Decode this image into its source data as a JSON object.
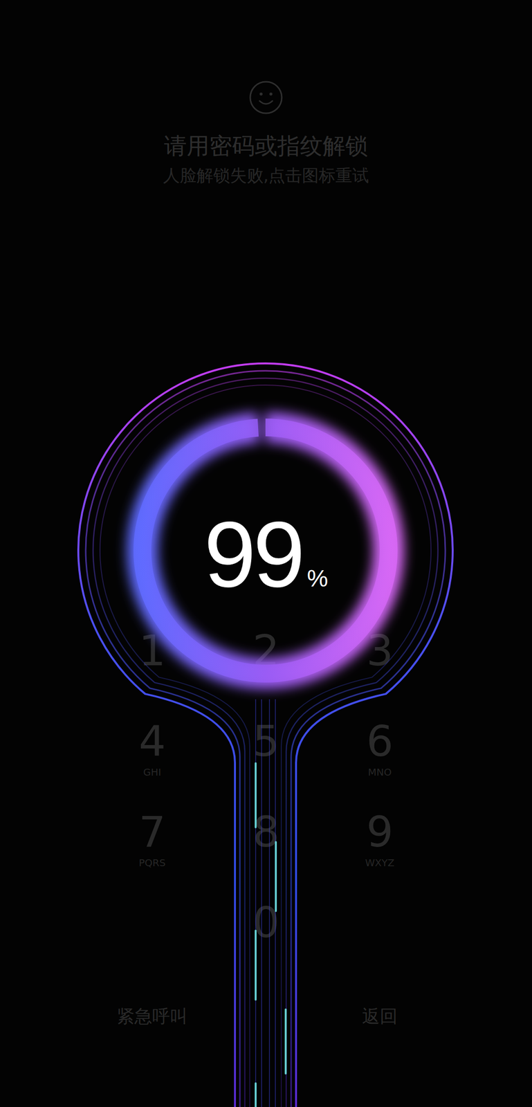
{
  "lock": {
    "title": "请用密码或指纹解锁",
    "subtitle": "人脸解锁失败,点击图标重试"
  },
  "keypad": [
    {
      "digit": "1",
      "letters": ""
    },
    {
      "digit": "2",
      "letters": ""
    },
    {
      "digit": "3",
      "letters": ""
    },
    {
      "digit": "4",
      "letters": "GHI"
    },
    {
      "digit": "5",
      "letters": ""
    },
    {
      "digit": "6",
      "letters": "MNO"
    },
    {
      "digit": "7",
      "letters": "PQRS"
    },
    {
      "digit": "8",
      "letters": ""
    },
    {
      "digit": "9",
      "letters": "WXYZ"
    },
    {
      "digit": "0",
      "letters": ""
    }
  ],
  "actions": [
    "紧急呼叫",
    "返回"
  ],
  "charging": {
    "percent": "99",
    "unit": "%",
    "level": 0.99
  }
}
